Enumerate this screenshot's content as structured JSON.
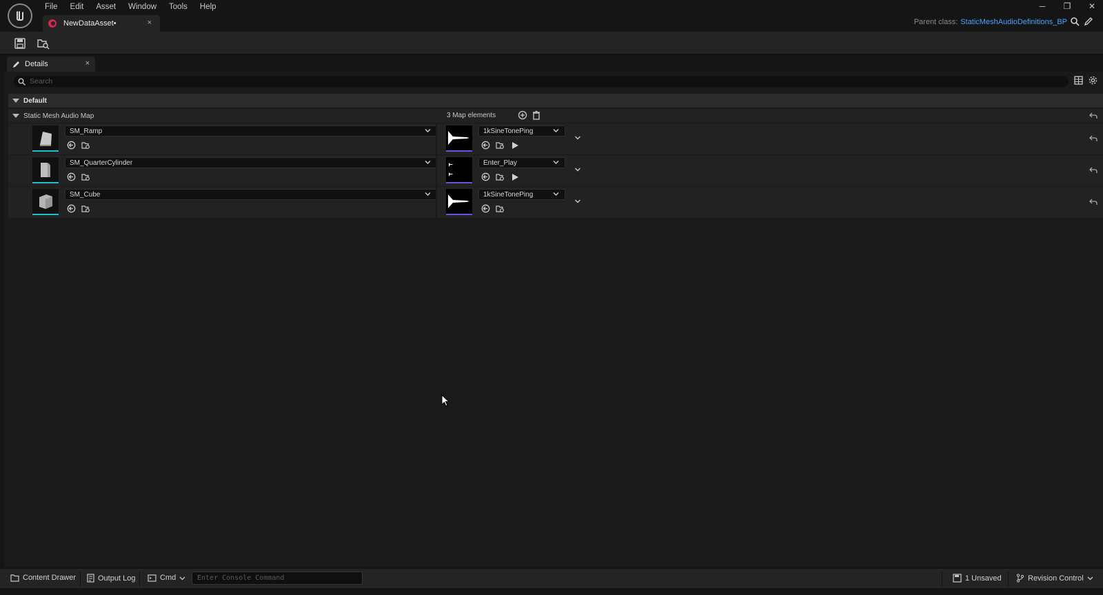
{
  "window": {
    "menu": [
      "File",
      "Edit",
      "Asset",
      "Window",
      "Tools",
      "Help"
    ],
    "tab_title": "NewDataAsset•",
    "tab_close": "×",
    "parent_class_label": "Parent class:",
    "parent_class_value": "StaticMeshAudioDefinitions_BP",
    "controls": {
      "minimize": "─",
      "restore": "❐",
      "close": "✕"
    }
  },
  "details_tab": {
    "label": "Details",
    "close": "×"
  },
  "search": {
    "placeholder": "Search"
  },
  "category": {
    "label": "Default"
  },
  "map_property": {
    "label": "Static Mesh Audio Map",
    "count_text": "3 Map elements",
    "entries": [
      {
        "mesh": "SM_Ramp",
        "sound": "1kSineTonePing",
        "playable": true
      },
      {
        "mesh": "SM_QuarterCylinder",
        "sound": "Enter_Play",
        "playable": true
      },
      {
        "mesh": "SM_Cube",
        "sound": "1kSineTonePing",
        "playable": false
      }
    ]
  },
  "statusbar": {
    "content_drawer": "Content Drawer",
    "output_log": "Output Log",
    "cmd": "Cmd",
    "console_placeholder": "Enter Console Command",
    "unsaved": "1 Unsaved",
    "revision_control": "Revision Control"
  },
  "colors": {
    "accent_link": "#4aa3ff",
    "mesh_thumb_underline": "#18c0d0",
    "sound_thumb_underline": "#6a4fe0",
    "asset_tab_icon": "#d0284f"
  }
}
